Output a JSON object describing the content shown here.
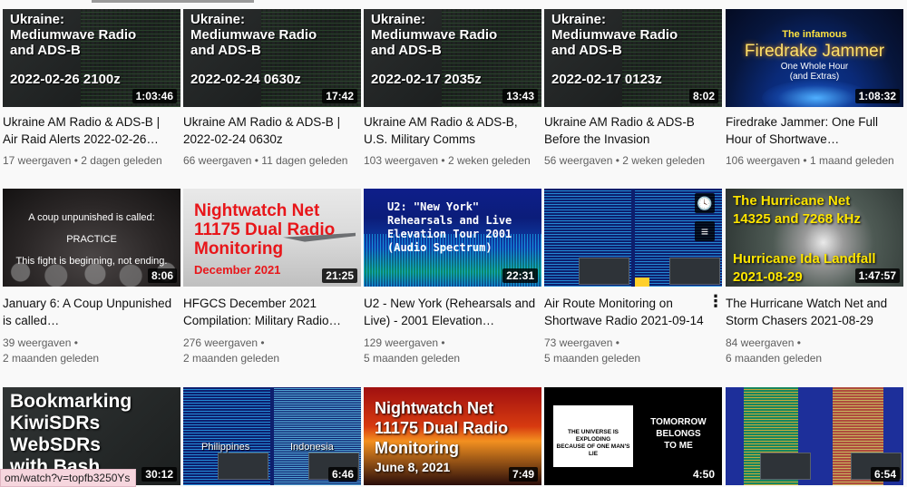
{
  "videos": [
    {
      "title": "Ukraine AM Radio & ADS-B | Air Raid Alerts 2022-02-26…",
      "views": "17 weergaven",
      "age": "2 dagen geleden",
      "duration": "1:03:46",
      "thumb": {
        "line1": "Ukraine:\nMediumwave Radio\nand ADS-B",
        "line2": "2022-02-26 2100z"
      }
    },
    {
      "title": "Ukraine AM Radio & ADS-B | 2022-02-24 0630z",
      "views": "66 weergaven",
      "age": "11 dagen geleden",
      "duration": "17:42",
      "thumb": {
        "line1": "Ukraine:\nMediumwave Radio\nand ADS-B",
        "line2": "2022-02-24 0630z"
      }
    },
    {
      "title": "Ukraine AM Radio & ADS-B, U.S. Military Comms",
      "views": "103 weergaven",
      "age": "2 weken geleden",
      "duration": "13:43",
      "thumb": {
        "line1": "Ukraine:\nMediumwave Radio\nand ADS-B",
        "line2": "2022-02-17 2035z"
      }
    },
    {
      "title": "Ukraine AM Radio & ADS-B Before the Invasion",
      "views": "56 weergaven",
      "age": "2 weken geleden",
      "duration": "8:02",
      "thumb": {
        "line1": "Ukraine:\nMediumwave Radio\nand ADS-B",
        "line2": "2022-02-17 0123z"
      }
    },
    {
      "title": "Firedrake Jammer: One Full Hour of Shortwave…",
      "views": "106 weergaven",
      "age": "1 maand geleden",
      "duration": "1:08:32",
      "thumb": {
        "line1": "The infamous",
        "line2": "Firedrake Jammer",
        "line3": "One Whole Hour\n(and Extras)"
      }
    },
    {
      "title": "January 6: A Coup Unpunished is called…",
      "views": "39 weergaven",
      "age": "2 maanden geleden",
      "duration": "8:06",
      "thumb": {
        "line1": "A coup unpunished is called:",
        "line2": "PRACTICE",
        "line3": "This fight is beginning, not ending."
      }
    },
    {
      "title": "HFGCS December 2021 Compilation: Military Radio…",
      "views": "276 weergaven",
      "age": "2 maanden geleden",
      "duration": "21:25",
      "thumb": {
        "line1": "Nightwatch Net\n11175 Dual Radio\nMonitoring",
        "line2": "December 2021"
      }
    },
    {
      "title": "U2 - New York (Rehearsals and Live) - 2001 Elevation…",
      "views": "129 weergaven",
      "age": "5 maanden geleden",
      "duration": "22:31",
      "thumb": {
        "line1": "U2: \"New York\"\nRehearsals and Live\nElevation Tour 2001\n(Audio Spectrum)"
      }
    },
    {
      "title": "Air Route Monitoring on Shortwave Radio 2021-09-14",
      "views": "73 weergaven",
      "age": "5 maanden geleden",
      "duration": "",
      "thumb": {
        "watch_later": "clock-icon",
        "queue": "add-to-queue-icon"
      }
    },
    {
      "title": "The Hurricane Watch Net and Storm Chasers 2021-08-29",
      "views": "84 weergaven",
      "age": "6 maanden geleden",
      "duration": "1:47:57",
      "thumb": {
        "line1": "The Hurricane Net\n14325 and 7268 kHz",
        "line2": "Hurricane Ida Landfall\n2021-08-29"
      }
    },
    {
      "duration": "30:12",
      "thumb": {
        "line1": "Bookmarking\nKiwiSDRs\nWebSDRs\n   with Bash"
      }
    },
    {
      "duration": "6:46",
      "thumb": {
        "label_left": "Philippines",
        "label_right": "Indonesia"
      }
    },
    {
      "duration": "7:49",
      "thumb": {
        "line1": "Nightwatch Net\n11175 Dual Radio\nMonitoring",
        "line2": "June 8, 2021"
      }
    },
    {
      "duration": "4:50",
      "thumb": {
        "box": "THE UNIVERSE IS EXPLODING\nBECAUSE OF ONE MAN'S LIE",
        "right": "TOMORROW\nBELONGS\nTO ME"
      }
    },
    {
      "duration": "6:54",
      "thumb": {}
    }
  ],
  "ui": {
    "separator": "•",
    "more_icon": "⋮",
    "status_url": "om/watch?v=topfb3250Ys"
  }
}
